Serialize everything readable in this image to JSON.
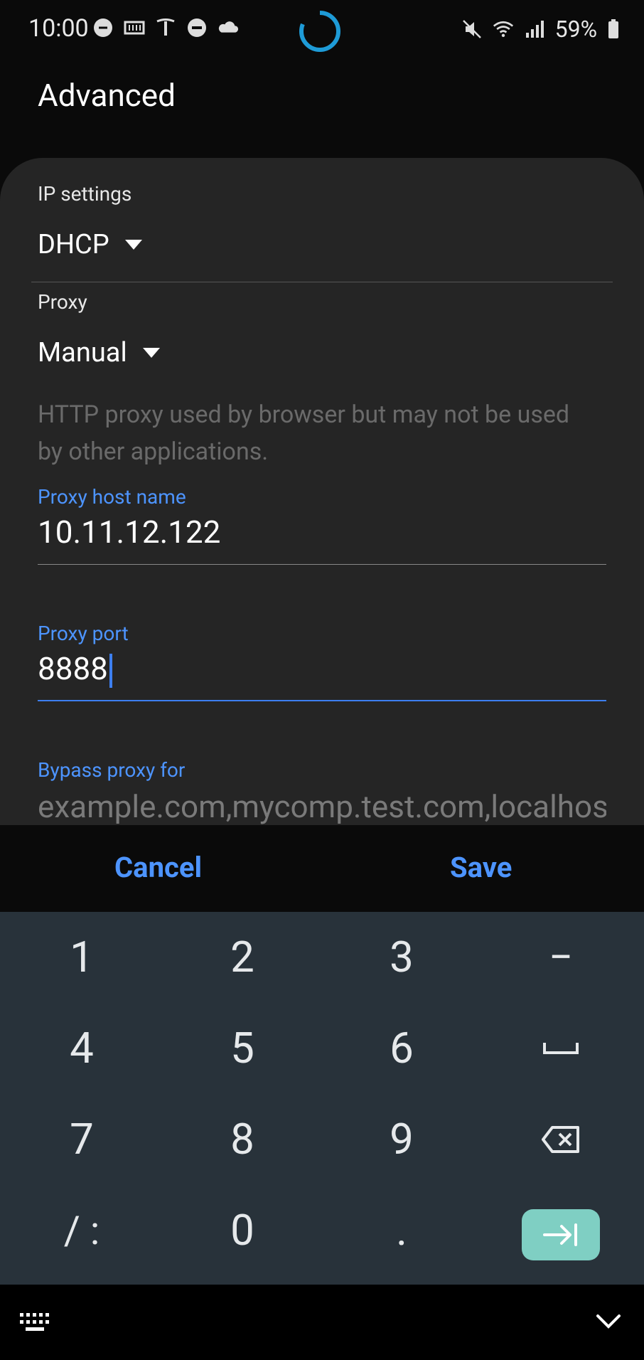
{
  "status_bar": {
    "time": "10:00",
    "battery": "59%",
    "left_icons": [
      "edge-icon",
      "ribbon-icon",
      "tesla-icon",
      "dnd-icon",
      "cloud-icon"
    ],
    "right_icons": [
      "mute-icon",
      "wifi-icon",
      "signal-icon",
      "battery-icon"
    ]
  },
  "screen": {
    "title": "Advanced"
  },
  "ip_settings": {
    "label": "IP settings",
    "value": "DHCP"
  },
  "proxy": {
    "label": "Proxy",
    "value": "Manual",
    "hint": "HTTP proxy used by browser but may not be used by other applications."
  },
  "proxy_host": {
    "label": "Proxy host name",
    "value": "10.11.12.122"
  },
  "proxy_port": {
    "label": "Proxy port",
    "value": "8888"
  },
  "bypass": {
    "label": "Bypass proxy for",
    "placeholder": "example.com,mycomp.test.com,localhost"
  },
  "actions": {
    "cancel": "Cancel",
    "save": "Save"
  },
  "keyboard": {
    "rows": [
      [
        "1",
        "2",
        "3",
        "−"
      ],
      [
        "4",
        "5",
        "6",
        "␣"
      ],
      [
        "7",
        "8",
        "9",
        "⌫"
      ],
      [
        "/ :",
        "0",
        ".",
        "⇥"
      ]
    ]
  },
  "colors": {
    "accent": "#4d94ff",
    "dialog_bg": "#252525",
    "keyboard_bg": "#28323a",
    "enter_key": "#7fcfc3"
  }
}
